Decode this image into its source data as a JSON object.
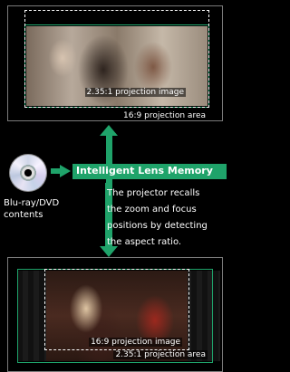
{
  "top_panel": {
    "image_label": "2.35:1 projection image",
    "area_label": "16:9 projection area"
  },
  "bottom_panel": {
    "image_label": "16:9 projection image",
    "area_label": "2.35:1 projection area"
  },
  "source": {
    "label_line1": "Blu-ray/DVD",
    "label_line2": "contents",
    "icon": "disc-icon"
  },
  "feature": {
    "title": "Intelligent Lens Memory",
    "desc_line1": "The projector recalls",
    "desc_line2": "the zoom and focus",
    "desc_line3": "positions by detecting",
    "desc_line4": "the aspect ratio."
  },
  "colors": {
    "accent": "#1fa36a",
    "background": "#000000"
  }
}
